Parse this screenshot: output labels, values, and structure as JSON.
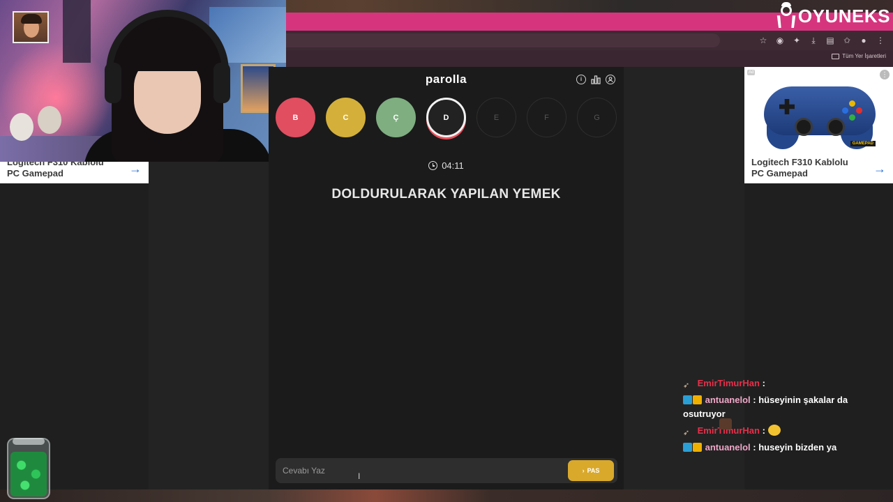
{
  "browser": {
    "bookmarks_all_label": "Tüm Yer İşaretleri",
    "toolbar_icons": [
      "star-icon",
      "extension-icon",
      "puzzle-icon",
      "download-icon",
      "reading-list-icon",
      "bookmark-star-icon",
      "profile-icon",
      "menu-icon"
    ]
  },
  "brand": {
    "logo_text": "OYUNEKS"
  },
  "ads": {
    "left": {
      "title": "Logitech F310 Kablolu PC Gamepad",
      "arrow": "→"
    },
    "right": {
      "title": "Logitech F310 Kablolu PC Gamepad",
      "arrow": "→",
      "badge": "Ad",
      "sticker": "GAMEPAD"
    }
  },
  "game": {
    "title": "parolla",
    "letters": [
      {
        "label": "B",
        "state": "done",
        "color": "#e04e60"
      },
      {
        "label": "C",
        "state": "done",
        "color": "#d4b03a"
      },
      {
        "label": "Ç",
        "state": "done",
        "color": "#7fae80"
      },
      {
        "label": "D",
        "state": "current",
        "color": "#222222"
      },
      {
        "label": "E",
        "state": "pending",
        "color": ""
      },
      {
        "label": "F",
        "state": "pending",
        "color": ""
      },
      {
        "label": "G",
        "state": "pending",
        "color": ""
      }
    ],
    "timer": "04:11",
    "question": "DOLDURULARAK YAPILAN YEMEK",
    "answer_placeholder": "Cevabı Yaz",
    "pass_label": "PAS",
    "pass_icon": "›"
  },
  "chat": [
    {
      "user": "EmirTimurHan",
      "sep": " : ",
      "text": "",
      "badges": [
        "rocket"
      ],
      "emote": "face",
      "user_color": "#e8304a"
    },
    {
      "user": "antuanelol",
      "sep": " : ",
      "text": "hüseyinin şakalar da osutruyor",
      "badges": [
        "prime",
        "crown"
      ],
      "emote": "",
      "user_color": "#f0a8c8"
    },
    {
      "user": "EmirTimurHan",
      "sep": " : ",
      "text": "",
      "badges": [
        "rocket"
      ],
      "emote": "hug",
      "user_color": "#e8304a"
    },
    {
      "user": "antuanelol",
      "sep": " : ",
      "text": "huseyin bizden ya",
      "badges": [
        "prime",
        "crown"
      ],
      "emote": "",
      "user_color": "#f0a8c8"
    }
  ],
  "colors": {
    "accent_pink": "#d6357e",
    "pass_yellow": "#d9a92c",
    "current_ring": "#e8505b"
  }
}
